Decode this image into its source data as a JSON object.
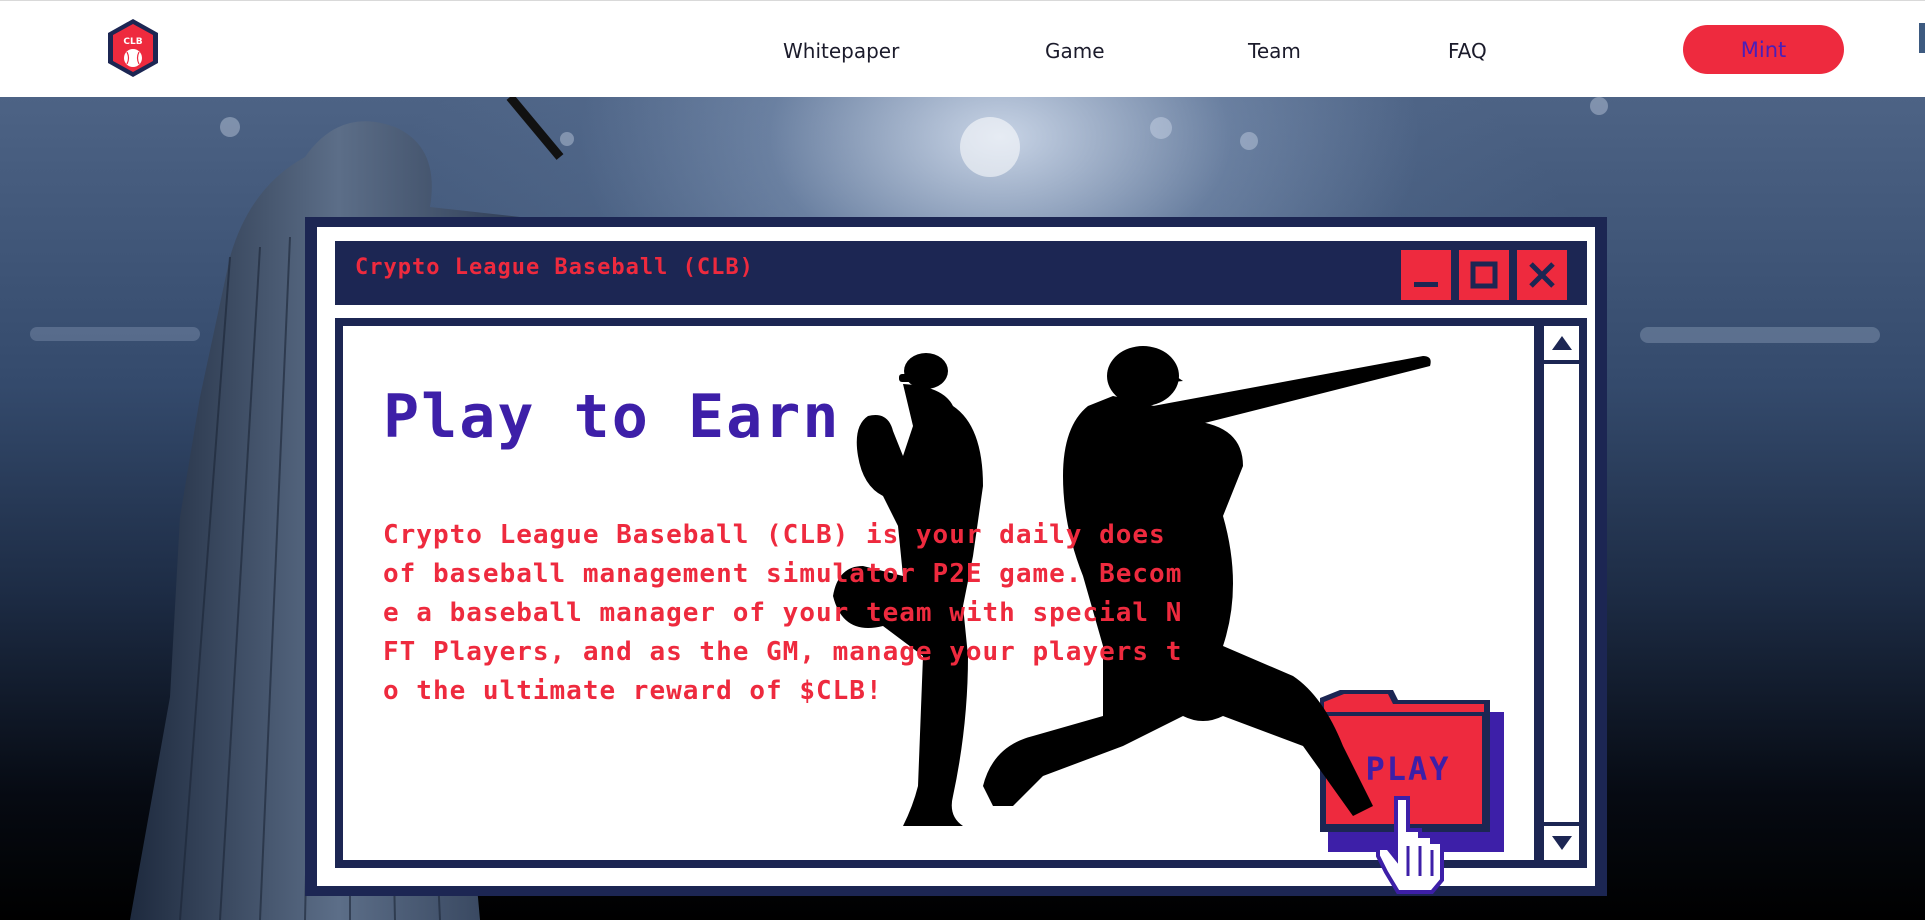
{
  "colors": {
    "navy": "#1c2653",
    "red": "#ee2a3e",
    "purple": "#3d1fa8",
    "white": "#ffffff"
  },
  "nav": {
    "logo_text": "CLB",
    "links": [
      "Whitepaper",
      "Game",
      "Team",
      "FAQ"
    ],
    "mint_label": "Mint"
  },
  "window": {
    "title": "Crypto League Baseball (CLB)",
    "controls": [
      "minimize-icon",
      "maximize-icon",
      "close-icon"
    ],
    "heading": "Play to Earn",
    "body_lines": [
      "Crypto League Baseball (CLB) is your daily does",
      "of baseball management simulator P2E game. Becom",
      "e a baseball manager of your team with special N",
      "FT Players, and as the GM, manage your players t",
      "o the ultimate reward of $CLB!"
    ],
    "play_label": "PLAY",
    "scroll_icons": [
      "arrow-up-icon",
      "arrow-down-icon"
    ]
  }
}
